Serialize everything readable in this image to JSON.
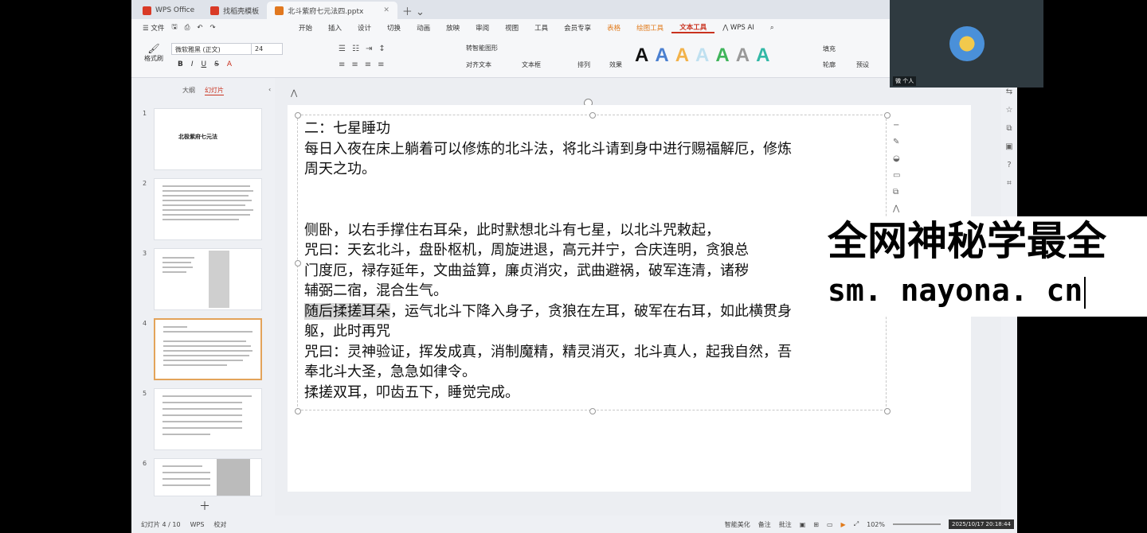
{
  "tabs": [
    {
      "label": "WPS Office",
      "color": "#d93a26"
    },
    {
      "label": "找稻壳模板",
      "color": "#d93a26"
    },
    {
      "label": "北斗紫府七元法四.pptx",
      "color": "#e1781f",
      "active": true
    }
  ],
  "menu": {
    "file": "文件",
    "items": [
      "开始",
      "插入",
      "设计",
      "切换",
      "动画",
      "放映",
      "审阅",
      "视图",
      "工具",
      "会员专享",
      "表格",
      "绘图工具",
      "文本工具"
    ],
    "ai": "WPS AI"
  },
  "ribbon": {
    "format_painter": "格式刷",
    "font_name": "微软雅黑 (正文)",
    "font_size": "24",
    "convert_shape": "转智能图形",
    "align_text": "对齐文本",
    "text_box": "文本框",
    "arrange": "排列",
    "fill": "填充",
    "outline": "轮廓",
    "effects": "效果",
    "preset": "预设"
  },
  "left_panel": {
    "tab_outline": "大纲",
    "tab_slides": "幻灯片",
    "thumb1_title": "北极紫府七元法",
    "slide_numbers": [
      "1",
      "2",
      "3",
      "4",
      "5",
      "6"
    ]
  },
  "slide": {
    "lines": [
      "二：七星睡功",
      "每日入夜在床上躺着可以修炼的北斗法，将北斗请到身中进行赐福解厄，修炼",
      "周天之功。",
      "",
      "",
      "侧卧，以右手撑住右耳朵，此时默想北斗有七星，以北斗咒敕起，",
      "咒曰：天玄北斗，盘卧枢机，周旋进退，高元并宁，合庆连明，贪狼总",
      "门度厄，禄存延年，文曲益算，廉贞消灾，武曲避祸，破军连清，诸秽",
      "辅弼二宿，混合生气。"
    ],
    "highlight": "随后揉搓耳朵",
    "line_after_highlight": "，运气北斗下降入身子，贪狼在左耳，破军在右耳，如此横贯身",
    "lines2": [
      "躯，此时再咒",
      "咒曰：灵神验证，挥发成真，消制魔精，精灵消灭，北斗真人，起我自然，吾",
      "奉北斗大圣，急急如律令。",
      "揉搓双耳，叩齿五下，睡觉完成。"
    ]
  },
  "status": {
    "slide_count": "幻灯片 4 / 10",
    "wps": "WPS",
    "proof": "校对",
    "smart_beautify": "智能美化",
    "notes": "备注",
    "comments": "批注",
    "zoom": "102%",
    "datetime": "2025/10/17 20:18:44"
  },
  "video": {
    "name": "微 个人"
  },
  "watermark": {
    "line1": "全网神秘学最全",
    "line2": "sm. nayona. cn"
  }
}
